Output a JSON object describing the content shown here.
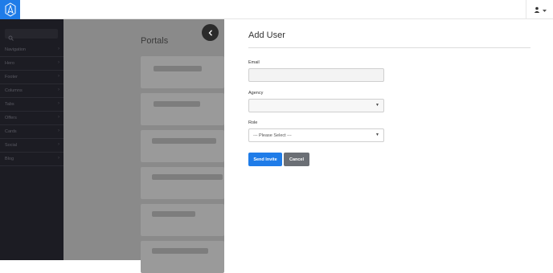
{
  "header": {
    "logo_icon": "portal-logo-icon",
    "user_icon": "user-icon",
    "caret_icon": "caret-down-icon"
  },
  "sidebar": {
    "search_icon": "search-icon",
    "items": [
      {
        "label": "Navigation"
      },
      {
        "label": "Hero"
      },
      {
        "label": "Footer"
      },
      {
        "label": "Columns"
      },
      {
        "label": "Tabs"
      },
      {
        "label": "Offers"
      },
      {
        "label": "Cards"
      },
      {
        "label": "Social"
      },
      {
        "label": "Blog"
      }
    ]
  },
  "main": {
    "title": "Portals"
  },
  "panel": {
    "title": "Add User",
    "email_label": "Email",
    "email_value": "",
    "agency_label": "Agency",
    "agency_value": "",
    "role_label": "Role",
    "role_value": "--- Please Select ---",
    "send_button": "Send Invite",
    "cancel_button": "Cancel"
  },
  "colors": {
    "accent": "#1f7ce8",
    "sidebar": "#1c1c23",
    "secondary_button": "#6b6f75"
  }
}
